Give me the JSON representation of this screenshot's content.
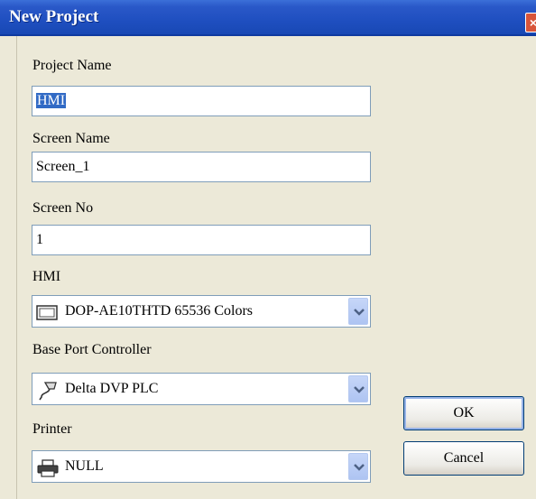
{
  "window": {
    "title": "New Project",
    "close_glyph": "×"
  },
  "form": {
    "project_name": {
      "label": "Project Name",
      "value": "HMI"
    },
    "screen_name": {
      "label": "Screen Name",
      "value": "Screen_1"
    },
    "screen_no": {
      "label": "Screen No",
      "value": "1"
    },
    "hmi": {
      "label": "HMI",
      "value": "DOP-AE10THTD 65536 Colors",
      "icon": "monitor-icon"
    },
    "base_port_controller": {
      "label": "Base Port Controller",
      "value": "Delta DVP PLC",
      "icon": "plug-icon"
    },
    "printer": {
      "label": "Printer",
      "value": "NULL",
      "icon": "printer-icon"
    }
  },
  "buttons": {
    "ok": "OK",
    "cancel": "Cancel"
  },
  "colors": {
    "title_bar": "#1f4fc0",
    "dialog_bg": "#ece9d8",
    "field_border": "#7f9db9",
    "selection": "#316ac5"
  }
}
